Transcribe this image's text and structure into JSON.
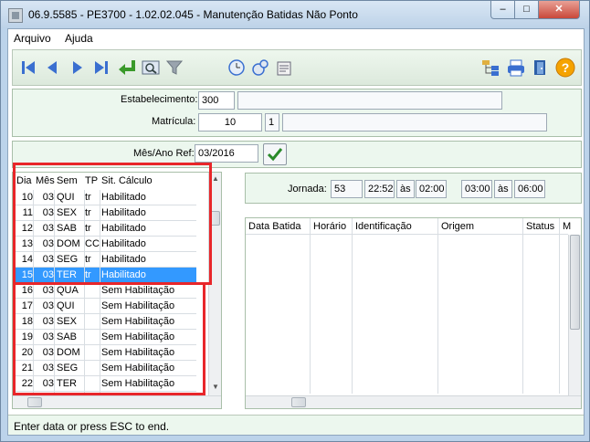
{
  "window": {
    "title": "06.9.5585 - PE3700 - 1.02.02.045 - Manutenção Batidas Não Ponto",
    "min_label": "–",
    "max_label": "□",
    "close_label": "✕"
  },
  "menu": {
    "arquivo": "Arquivo",
    "ajuda": "Ajuda"
  },
  "form": {
    "estabelecimento_label": "Estabelecimento:",
    "estabelecimento_value": "300",
    "estabelecimento_desc": "",
    "matricula_label": "Matrícula:",
    "matricula_value": "10",
    "matricula_digit": "1",
    "matricula_name": "",
    "mes_ano_label": "Mês/Ano Ref:",
    "mes_ano_value": "03/2016"
  },
  "days_table": {
    "headers": [
      "Dia",
      "Mês",
      "Sem",
      "TP",
      "Sit. Cálculo"
    ],
    "rows": [
      {
        "dia": "10",
        "mes": "03",
        "sem": "QUI",
        "tp": "tr",
        "sit": "Habilitado"
      },
      {
        "dia": "11",
        "mes": "03",
        "sem": "SEX",
        "tp": "tr",
        "sit": "Habilitado"
      },
      {
        "dia": "12",
        "mes": "03",
        "sem": "SAB",
        "tp": "tr",
        "sit": "Habilitado"
      },
      {
        "dia": "13",
        "mes": "03",
        "sem": "DOM",
        "tp": "CC",
        "sit": "Habilitado"
      },
      {
        "dia": "14",
        "mes": "03",
        "sem": "SEG",
        "tp": "tr",
        "sit": "Habilitado"
      },
      {
        "dia": "15",
        "mes": "03",
        "sem": "TER",
        "tp": "tr",
        "sit": "Habilitado"
      },
      {
        "dia": "16",
        "mes": "03",
        "sem": "QUA",
        "tp": "",
        "sit": "Sem Habilitação"
      },
      {
        "dia": "17",
        "mes": "03",
        "sem": "QUI",
        "tp": "",
        "sit": "Sem Habilitação"
      },
      {
        "dia": "18",
        "mes": "03",
        "sem": "SEX",
        "tp": "",
        "sit": "Sem Habilitação"
      },
      {
        "dia": "19",
        "mes": "03",
        "sem": "SAB",
        "tp": "",
        "sit": "Sem Habilitação"
      },
      {
        "dia": "20",
        "mes": "03",
        "sem": "DOM",
        "tp": "",
        "sit": "Sem Habilitação"
      },
      {
        "dia": "21",
        "mes": "03",
        "sem": "SEG",
        "tp": "",
        "sit": "Sem Habilitação"
      },
      {
        "dia": "22",
        "mes": "03",
        "sem": "TER",
        "tp": "",
        "sit": "Sem Habilitação"
      }
    ]
  },
  "jornada": {
    "label": "Jornada:",
    "code": "53",
    "t1_start": "22:52",
    "as1": "às",
    "t1_end": "02:00",
    "t2_start": "03:00",
    "as2": "às",
    "t2_end": "06:00"
  },
  "batidas_table": {
    "headers": [
      "Data Batida",
      "Horário",
      "Identificação",
      "Origem",
      "Status",
      "M"
    ]
  },
  "status_bar": {
    "text": "Enter data or press ESC to end."
  },
  "colors": {
    "selection": "#3399ff",
    "highlight_box": "#e8262a",
    "panel_bg": "#ecf7ee"
  }
}
